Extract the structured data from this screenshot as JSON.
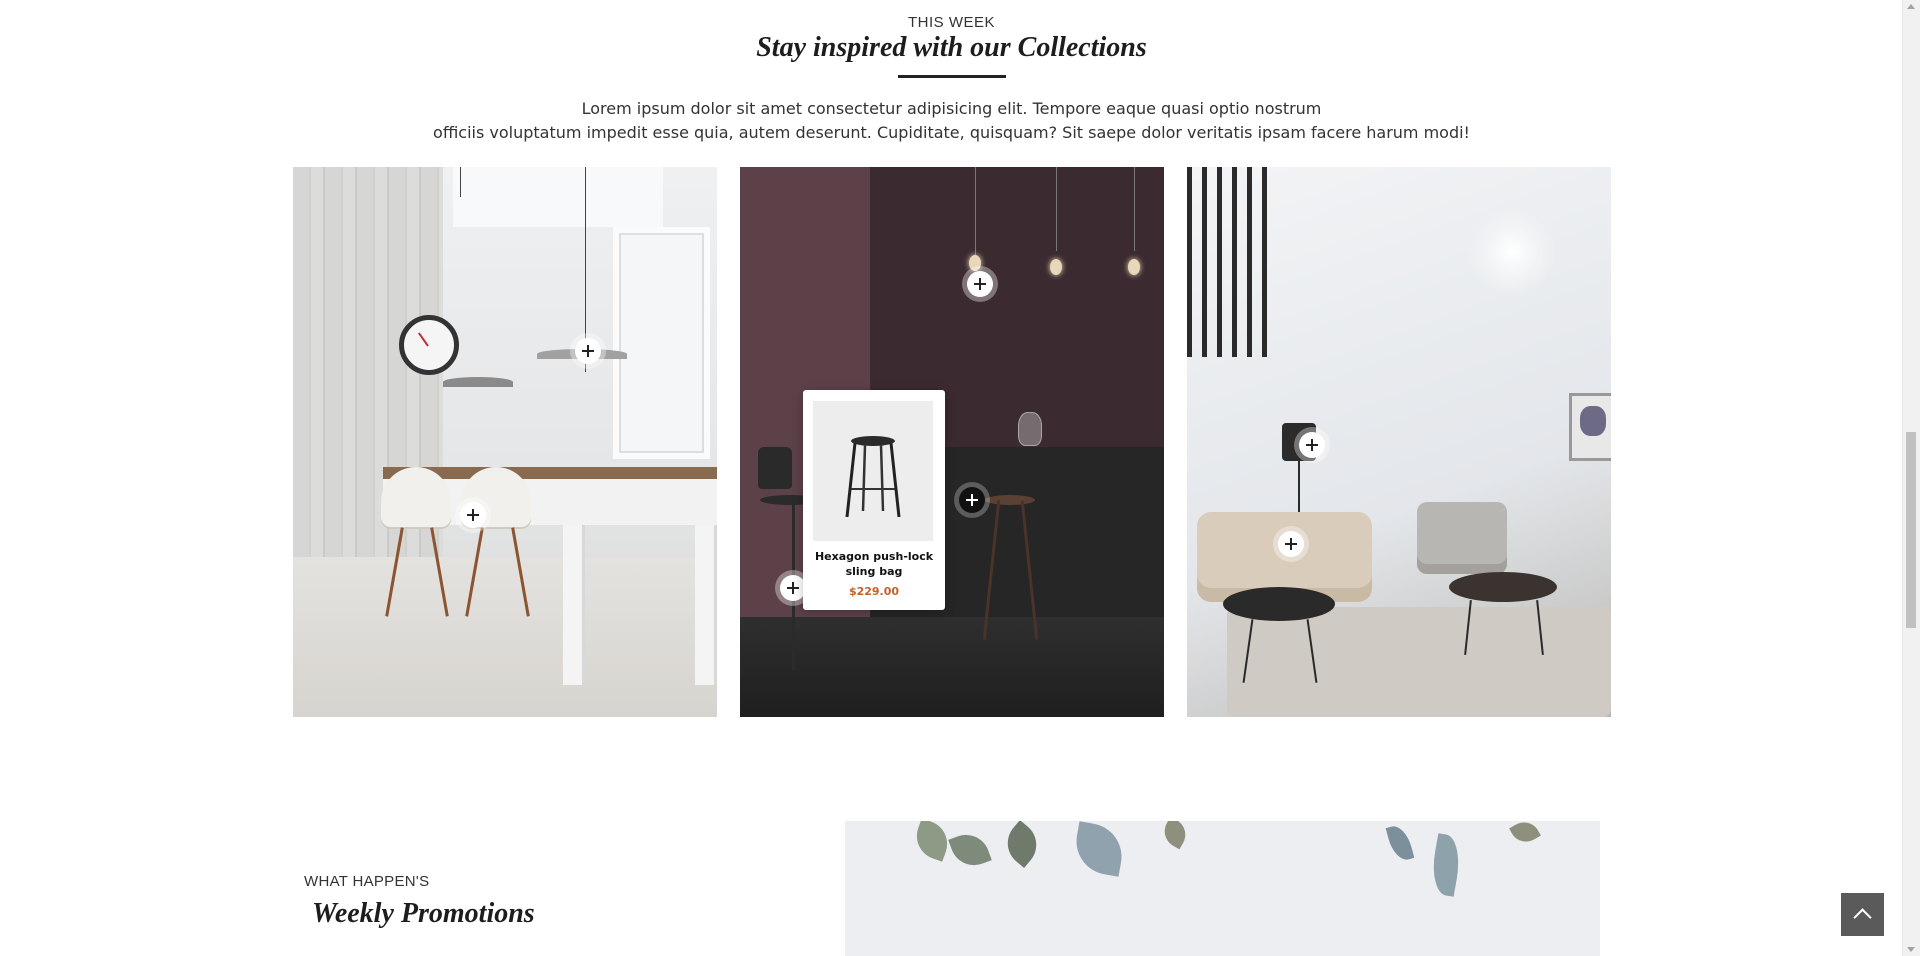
{
  "collections": {
    "eyebrow": "THIS WEEK",
    "title": "Stay inspired with our Collections",
    "intro_line1": "Lorem ipsum dolor sit amet consectetur adipisicing elit. Tempore eaque quasi optio nostrum",
    "intro_line2": "officiis voluptatum impedit esse quia, autem deserunt. Cupiditate, quisquam? Sit saepe dolor veritatis ipsam facere harum modi!"
  },
  "product_card": {
    "name": "Hexagon push-lock sling bag",
    "price": "$229.00"
  },
  "promotions": {
    "eyebrow": "WHAT HAPPEN'S",
    "title": "Weekly Promotions"
  },
  "colors": {
    "accent_price": "#c4602b",
    "back_to_top_bg": "#5a5a5a"
  }
}
